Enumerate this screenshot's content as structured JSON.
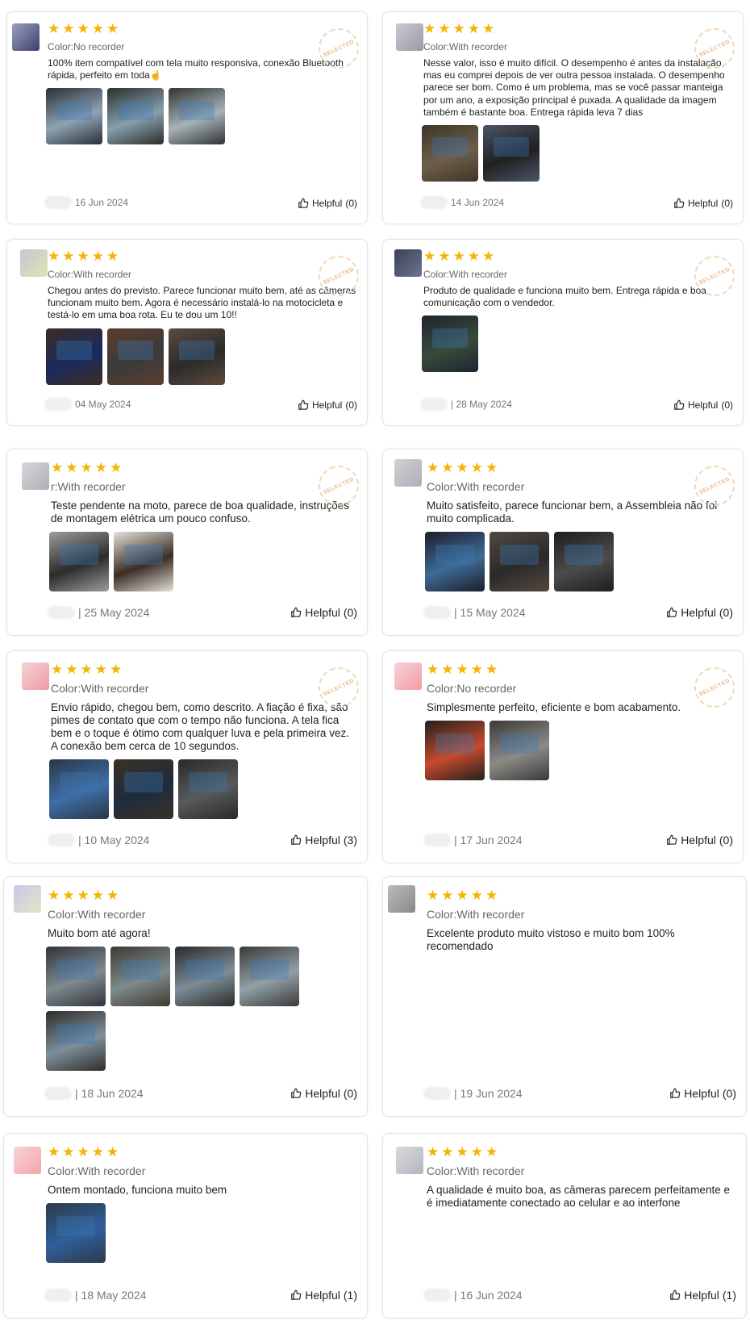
{
  "ui": {
    "helpful_label": "Helpful",
    "badge_text": "SELECTED",
    "star_icon": "star-icon",
    "thumb_icon": "thumbs-up-icon"
  },
  "reviews": [
    {
      "color_label": "Color:No recorder",
      "text": "100% item compatível com tela muito responsiva, conexão Bluetooth rápida, perfeito em toda☝",
      "date": "16 Jun 2024",
      "helpful": "(0)"
    },
    {
      "color_label": "Color:With recorder",
      "text": "Nesse valor, isso é muito difícil. O desempenho é antes da instalação, mas eu comprei depois de ver outra pessoa instalada. O desempenho parece ser bom. Como é um problema, mas se você passar manteiga por um ano, a exposição principal é puxada. A qualidade da imagem também é bastante boa. Entrega rápida leva 7 dias",
      "date": "14 Jun 2024",
      "helpful": "(0)"
    },
    {
      "color_label": "Color:With recorder",
      "text": "Chegou antes do previsto. Parece funcionar muito bem, até as câmeras funcionam muito bem. Agora é necessário instalá-lo na motocicleta e testá-lo em uma boa rota. Eu te dou um 10!!",
      "date": "04 May 2024",
      "helpful": "(0)"
    },
    {
      "color_label": "Color:With recorder",
      "text": "Produto de qualidade e funciona muito bem. Entrega rápida e boa comunicação com o vendedor.",
      "date": "| 28 May 2024",
      "helpful": "(0)"
    },
    {
      "color_label": "r:With recorder",
      "text": "Teste pendente na moto, parece de boa qualidade, instruções de montagem elétrica um pouco confuso.",
      "date": "| 25 May 2024",
      "helpful": "(0)"
    },
    {
      "color_label": "Color:With recorder",
      "text": "Muito satisfeito, parece funcionar bem, a Assembleia não foi muito complicada.",
      "date": "| 15 May 2024",
      "helpful": "(0)"
    },
    {
      "color_label": "Color:With recorder",
      "text": "Envio rápido, chegou bem, como descrito. A fiação é fixa, são pimes de contato que com o tempo não funciona. A tela fica bem e o toque é ótimo com qualquer luva e pela primeira vez. A conexão bem cerca de 10 segundos.",
      "date": "| 10 May 2024",
      "helpful": "(3)"
    },
    {
      "color_label": "Color:No recorder",
      "text": "Simplesmente perfeito, eficiente e bom acabamento.",
      "date": "| 17 Jun 2024",
      "helpful": "(0)"
    },
    {
      "color_label": "Color:With recorder",
      "text": "Muito bom até agora!",
      "date": "| 18 Jun 2024",
      "helpful": "(0)"
    },
    {
      "color_label": "Color:With recorder",
      "text": "Excelente produto muito vistoso e muito bom 100% recomendado",
      "date": "| 19 Jun 2024",
      "helpful": "(0)"
    },
    {
      "color_label": "Color:With recorder",
      "text": "Ontem montado, funciona muito bem",
      "date": "| 18 May 2024",
      "helpful": "(1)"
    },
    {
      "color_label": "Color:With recorder",
      "text": "A qualidade é muito boa, as câmeras parecem perfeitamente e é imediatamente conectado ao celular e ao interfone",
      "date": "| 16 Jun 2024",
      "helpful": "(1)"
    }
  ]
}
